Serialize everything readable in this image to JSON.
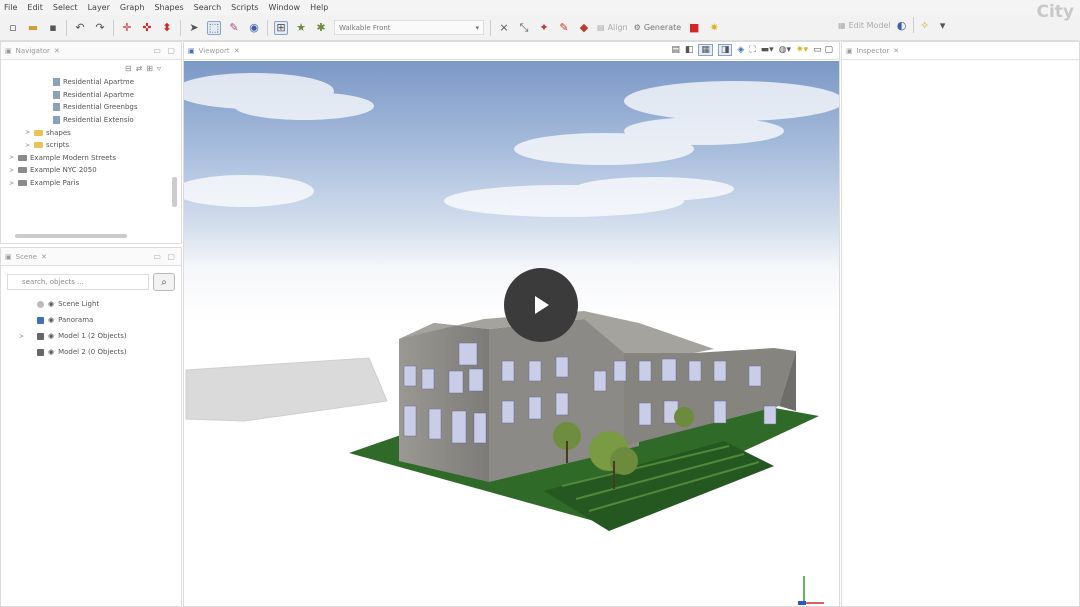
{
  "app": {
    "brand": "City"
  },
  "menu": [
    "File",
    "Edit",
    "Select",
    "Layer",
    "Graph",
    "Shapes",
    "Search",
    "Scripts",
    "Window",
    "Help"
  ],
  "toolbar": {
    "layer_combo_value": "Walkable Front",
    "align_label": "Align",
    "generate_label": "Generate",
    "edit_model_label": "Edit Model"
  },
  "navigator": {
    "tab_label": "Navigator",
    "items": [
      {
        "label": "Residential Apartme",
        "kind": "file",
        "indent": 3
      },
      {
        "label": "Residential Apartme",
        "kind": "file",
        "indent": 3
      },
      {
        "label": "Residential Greenbgs",
        "kind": "file",
        "indent": 3
      },
      {
        "label": "Residential Extensio",
        "kind": "file",
        "indent": 3
      },
      {
        "label": "shapes",
        "kind": "folder",
        "indent": 2,
        "arrow": ">"
      },
      {
        "label": "scripts",
        "kind": "folder",
        "indent": 2,
        "arrow": ">"
      },
      {
        "label": "Example Modern Streets",
        "kind": "folder",
        "indent": 1,
        "arrow": ">"
      },
      {
        "label": "Example NYC 2050",
        "kind": "folder",
        "indent": 1,
        "arrow": ">"
      },
      {
        "label": "Example Paris",
        "kind": "folder",
        "indent": 1,
        "arrow": ">"
      }
    ]
  },
  "scene": {
    "tab_label": "Scene",
    "search_placeholder": "search, objects ...",
    "items": [
      {
        "label": "Scene Light",
        "icon": "light"
      },
      {
        "label": "Panorama",
        "icon": "panorama"
      },
      {
        "label": "Model 1 (2 Objects)",
        "icon": "layer",
        "arrow": ">"
      },
      {
        "label": "Model 2 (0 Objects)",
        "icon": "layer"
      }
    ]
  },
  "viewport": {
    "tab_label": "Viewport"
  },
  "inspector": {
    "tab_label": "Inspector"
  },
  "video": {
    "play_label": "Play video"
  },
  "colors": {
    "play_button": "#3b3b3b",
    "ground": "#2f6a28",
    "building": "#8c8a86",
    "sky_top": "#7c98c6"
  }
}
